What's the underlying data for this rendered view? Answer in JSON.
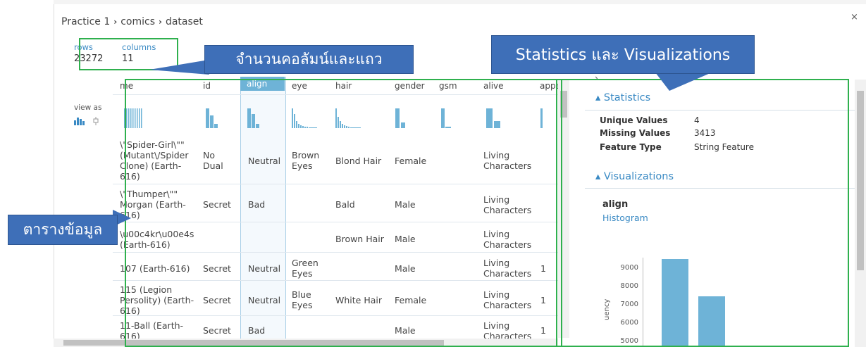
{
  "breadcrumb": {
    "part1": "Practice 1",
    "part2": "comics",
    "part3": "dataset"
  },
  "close_label": "×",
  "meta": {
    "rows_label": "rows",
    "rows_value": "23272",
    "columns_label": "columns",
    "columns_value": "11"
  },
  "view_as_label": "view as",
  "callouts": {
    "columns_rows": "จำนวนคอลัมน์และแถว",
    "stats_vis": "Statistics และ Visualizations",
    "data_table": "ตารางข้อมูล"
  },
  "columns": [
    "me",
    "id",
    "align",
    "eye",
    "hair",
    "gender",
    "gsm",
    "alive",
    "appe"
  ],
  "rows": [
    [
      "\\\"Spider-Girl\\\"\" (Mutant\\/Spider Clone) (Earth-616)",
      "No Dual",
      "Neutral",
      "Brown Eyes",
      "Blond Hair",
      "Female",
      "",
      "Living Characters",
      ""
    ],
    [
      "\\\"Thumper\\\"\" Morgan (Earth-616)",
      "Secret",
      "Bad",
      "",
      "Bald",
      "Male",
      "",
      "Living Characters",
      ""
    ],
    [
      "\\u00c4kr\\u00e4s (Earth-616)",
      "",
      "",
      "",
      "Brown Hair",
      "Male",
      "",
      "Living Characters",
      ""
    ],
    [
      "107 (Earth-616)",
      "Secret",
      "Neutral",
      "Green Eyes",
      "",
      "Male",
      "",
      "Living Characters",
      "1"
    ],
    [
      "115 (Legion Persolity) (Earth-616)",
      "Secret",
      "Neutral",
      "Blue Eyes",
      "White Hair",
      "Female",
      "",
      "Living Characters",
      "1"
    ],
    [
      "11-Ball (Earth-616)",
      "Secret",
      "Bad",
      "",
      "",
      "Male",
      "",
      "Living Characters",
      "1"
    ]
  ],
  "statistics": {
    "title": "Statistics",
    "items": [
      {
        "label": "Unique Values",
        "value": "4"
      },
      {
        "label": "Missing Values",
        "value": "3413"
      },
      {
        "label": "Feature Type",
        "value": "String Feature"
      }
    ]
  },
  "visualizations": {
    "title": "Visualizations",
    "feature": "align",
    "chart_type_label": "Histogram",
    "ylabel_fragment": "uency"
  },
  "chart_data": {
    "type": "bar",
    "title": "align",
    "ylabel": "Frequency",
    "y_ticks": [
      9000,
      8000,
      7000,
      6000,
      5000
    ],
    "visible_bar_tops": [
      9500,
      7450
    ]
  },
  "colors": {
    "accent": "#3a8ac4",
    "bar": "#6eb3d7",
    "highlight_box": "#2fb04e",
    "callout": "#3e6fb8"
  }
}
